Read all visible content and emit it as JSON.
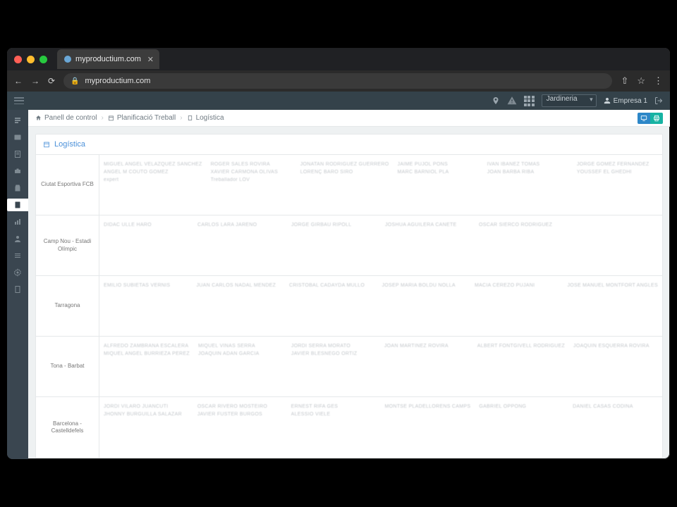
{
  "browser": {
    "tab_title": "myproductium.com",
    "url": "myproductium.com"
  },
  "topbar": {
    "select_value": "Jardineria",
    "user_label": "Empresa 1"
  },
  "breadcrumb": {
    "items": [
      {
        "label": "Panell de control"
      },
      {
        "label": "Planificació Treball"
      },
      {
        "label": "Logística"
      }
    ]
  },
  "panel": {
    "title": "Logística"
  },
  "rows": [
    {
      "label": "Ciutat Esportiva FCB",
      "cols": [
        [
          "MIGUEL ANGEL VELAZQUEZ SANCHEZ",
          "ANGEL M COUTO GOMEZ",
          "expert"
        ],
        [
          "ROGER SALES ROVIRA",
          "XAVIER CARMONA OLIVAS",
          "Treballador LOV"
        ],
        [
          "JONATAN RODRIGUEZ GUERRERO",
          "LORENÇ BARO SIRO"
        ],
        [
          "JAIME PUJOL PONS",
          "MARC BARNIOL PLA"
        ],
        [
          "IVAN IBÁÑEZ TOMAS",
          "JOAN BARBA RIBA"
        ],
        [
          "JORGE GOMEZ FERNANDEZ",
          "YOUSSEF EL GHEDHI"
        ]
      ]
    },
    {
      "label": "Camp Nou - Estadi Olímpic",
      "cols": [
        [
          "DIDAC ULLE HARO"
        ],
        [
          "CARLOS LARA JAREÑO"
        ],
        [
          "JORGE GIRBAU RIPOLL"
        ],
        [
          "JOSHUA AGUILERA CAÑETE"
        ],
        [
          "OSCAR SIERCO RODRIGUEZ"
        ],
        []
      ]
    },
    {
      "label": "Tarragona",
      "cols": [
        [
          "EMILIO SUBIETAS VERNIS"
        ],
        [
          "JUAN CARLOS NADAL MENDEZ"
        ],
        [
          "CRISTOBAL CADAYDA MULLO"
        ],
        [
          "JOSEP MARIA BOLDU NOLLA"
        ],
        [
          "MACIA CEREZO PUJANI"
        ],
        [
          "JOSE MANUEL MONTFORT ANGLES"
        ]
      ]
    },
    {
      "label": "Tona - Barbat",
      "cols": [
        [
          "ALFREDO ZAMBRANA ESCALERA",
          "MIQUEL ANGEL BURRIEZA PEREZ"
        ],
        [
          "MIQUEL VIÑAS SERRA",
          "JOAQUIN ADAN GARCIA"
        ],
        [
          "JORDI SERRA MORATO",
          "JAVIER BLESNEGO ORTIZ"
        ],
        [
          "JOAN MARTINEZ ROVIRA"
        ],
        [
          "ALBERT FONTGIVELL RODRIGUEZ"
        ],
        [
          "JOAQUIN ESQUERRA ROVIRA"
        ]
      ]
    },
    {
      "label": "Barcelona - Castelldefels",
      "cols": [
        [
          "JORDI VILARO JUANCUTI",
          "JHONNY BURGUILLA SALAZAR"
        ],
        [
          "OSCAR RIVERO MOSTEIRO",
          "JAVIER FUSTER BURGOS"
        ],
        [
          "ERNEST RIFA GES",
          "ALESSIO VIELE"
        ],
        [
          "MONTSE PLADELLORENS CAMPS"
        ],
        [
          "GABRIEL OPPONG"
        ],
        [
          "DANIEL CASAS CODINA"
        ]
      ]
    }
  ]
}
